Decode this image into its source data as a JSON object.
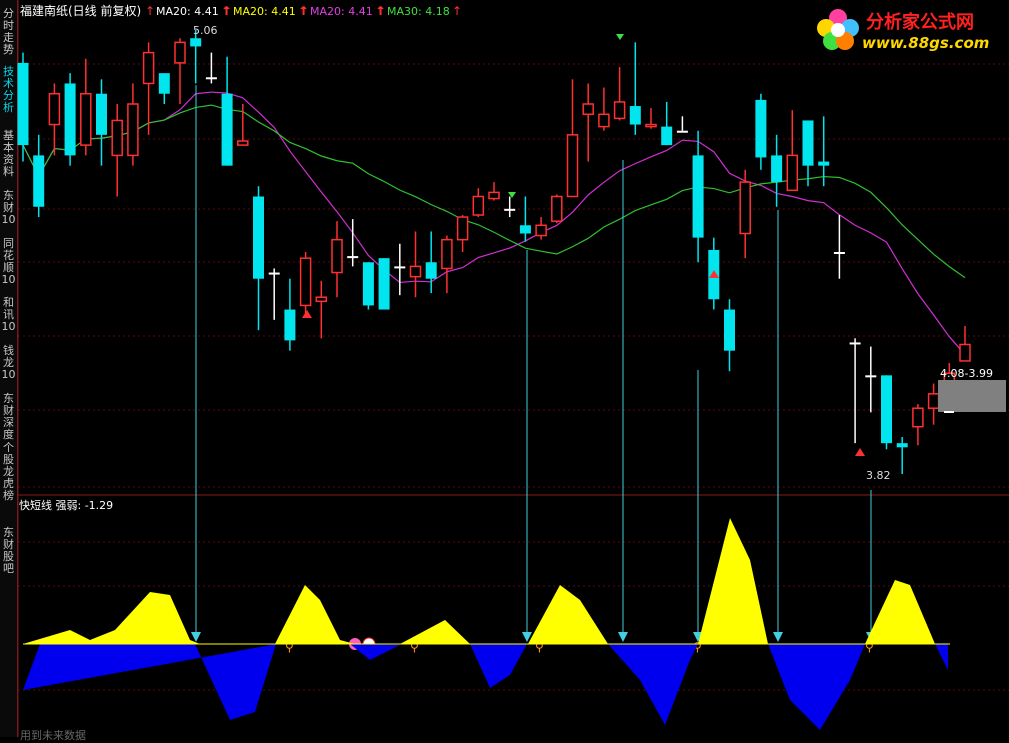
{
  "sidebar": {
    "tabs": [
      {
        "label": "分时走势",
        "active": false
      },
      {
        "label": "技术分析",
        "active": true
      },
      {
        "label": "基本资料",
        "active": false
      },
      {
        "label": "东财10",
        "active": false
      },
      {
        "label": "同花顺10",
        "active": false
      },
      {
        "label": "和讯10",
        "active": false
      },
      {
        "label": "钱龙10",
        "active": false
      },
      {
        "label": "东财深度",
        "active": false
      },
      {
        "label": "个股龙虎榜",
        "active": false
      },
      {
        "label": "东财股吧",
        "active": false
      }
    ]
  },
  "header": {
    "title": "福建南纸(日线 前复权)",
    "ma_legend": [
      {
        "text": "MA20: 4.41",
        "color": "#ffffff"
      },
      {
        "text": "MA20: 4.41",
        "color": "#ffff00"
      },
      {
        "text": "MA20: 4.41",
        "color": "#e040e0"
      },
      {
        "text": "MA30: 4.18",
        "color": "#40e040"
      }
    ]
  },
  "logo": {
    "name": "分析家公式网",
    "url": "www.88gs.com"
  },
  "annotations": {
    "high_label": "5.06",
    "low_label": "3.82",
    "range_label": "4.08-3.99"
  },
  "indicator": {
    "title": "快短线 强弱: -1.29"
  },
  "footer": {
    "note": "用到未来数据"
  },
  "colors": {
    "up": "#ff3030",
    "down": "#00e5ee",
    "ma_pink": "#d030d0",
    "ma_green": "#30c030",
    "yellow": "#ffff00",
    "blue": "#0000ee",
    "grid": "#5a0a0a"
  },
  "chart_data": {
    "type": "candlestick",
    "candles": [
      [
        4.9,
        4.5,
        4.95,
        4.42
      ],
      [
        4.45,
        4.2,
        4.55,
        4.15
      ],
      [
        4.6,
        4.75,
        4.8,
        4.45
      ],
      [
        4.8,
        4.45,
        4.85,
        4.4
      ],
      [
        4.5,
        4.75,
        4.92,
        4.45
      ],
      [
        4.75,
        4.55,
        4.82,
        4.4
      ],
      [
        4.45,
        4.62,
        4.7,
        4.25
      ],
      [
        4.45,
        4.7,
        4.8,
        4.4
      ],
      [
        4.8,
        4.95,
        5.0,
        4.55
      ],
      [
        4.85,
        4.75,
        4.85,
        4.7
      ],
      [
        4.9,
        5.0,
        5.02,
        4.7
      ],
      [
        5.02,
        4.98,
        5.06,
        4.8
      ],
      [
        4.83,
        4.83,
        4.95,
        4.8
      ],
      [
        4.75,
        4.4,
        4.93,
        4.4
      ],
      [
        4.5,
        4.52,
        4.7,
        4.5
      ],
      [
        4.25,
        3.85,
        4.3,
        3.6
      ],
      [
        3.88,
        3.88,
        3.9,
        3.65
      ],
      [
        3.7,
        3.55,
        3.85,
        3.5
      ],
      [
        3.72,
        3.95,
        3.98,
        3.68
      ],
      [
        3.74,
        3.76,
        3.84,
        3.56
      ],
      [
        3.88,
        4.04,
        4.13,
        3.76
      ],
      [
        3.96,
        3.96,
        4.14,
        3.91
      ],
      [
        3.93,
        3.72,
        3.93,
        3.7
      ],
      [
        3.95,
        3.7,
        3.95,
        3.7
      ],
      [
        3.91,
        3.91,
        4.02,
        3.77
      ],
      [
        3.86,
        3.91,
        4.08,
        3.76
      ],
      [
        3.93,
        3.85,
        4.08,
        3.78
      ],
      [
        3.9,
        4.04,
        4.06,
        3.78
      ],
      [
        4.04,
        4.15,
        4.16,
        3.98
      ],
      [
        4.16,
        4.25,
        4.29,
        4.15
      ],
      [
        4.24,
        4.27,
        4.32,
        4.23
      ],
      [
        4.19,
        4.19,
        4.25,
        4.15
      ],
      [
        4.11,
        4.07,
        4.25,
        4.03
      ],
      [
        4.06,
        4.11,
        4.15,
        4.04
      ],
      [
        4.13,
        4.25,
        4.26,
        4.12
      ],
      [
        4.25,
        4.55,
        4.82,
        4.25
      ],
      [
        4.65,
        4.7,
        4.8,
        4.42
      ],
      [
        4.59,
        4.65,
        4.78,
        4.57
      ],
      [
        4.63,
        4.71,
        4.88,
        4.62
      ],
      [
        4.69,
        4.6,
        5.0,
        4.55
      ],
      [
        4.59,
        4.6,
        4.68,
        4.58
      ],
      [
        4.59,
        4.5,
        4.71,
        4.5
      ],
      [
        4.57,
        4.57,
        4.64,
        4.57
      ],
      [
        4.45,
        4.05,
        4.57,
        3.93
      ],
      [
        3.99,
        3.75,
        4.05,
        3.7
      ],
      [
        3.7,
        3.5,
        3.75,
        3.4
      ],
      [
        4.07,
        4.32,
        4.38,
        3.95
      ],
      [
        4.72,
        4.44,
        4.75,
        4.38
      ],
      [
        4.45,
        4.32,
        4.55,
        4.2
      ],
      [
        4.28,
        4.45,
        4.67,
        4.28
      ],
      [
        4.62,
        4.4,
        4.62,
        4.3
      ],
      [
        4.42,
        4.4,
        4.64,
        4.3
      ],
      [
        3.98,
        3.98,
        4.16,
        3.85
      ],
      [
        3.54,
        3.54,
        3.56,
        3.05
      ],
      [
        3.38,
        3.38,
        3.52,
        3.2
      ],
      [
        3.38,
        3.05,
        3.38,
        3.02
      ],
      [
        3.05,
        3.03,
        3.08,
        2.9
      ],
      [
        3.13,
        3.22,
        3.24,
        3.04
      ],
      [
        3.22,
        3.29,
        3.34,
        3.14
      ],
      [
        3.3,
        3.39,
        3.44,
        3.22
      ],
      [
        3.45,
        3.53,
        3.62,
        3.45
      ]
    ]
  }
}
